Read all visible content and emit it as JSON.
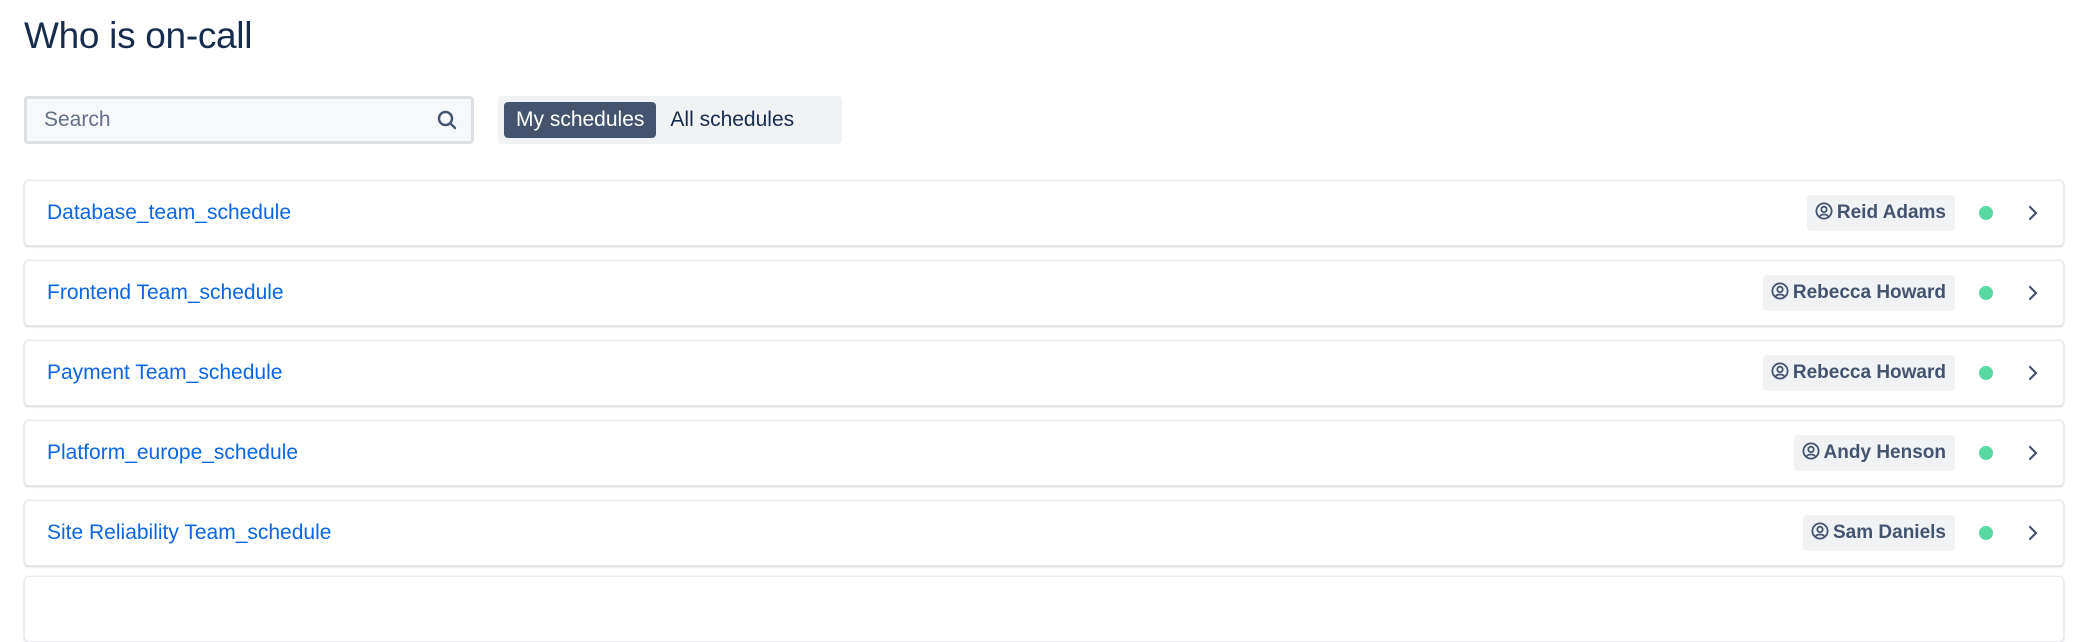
{
  "page": {
    "title": "Who is on-call"
  },
  "search": {
    "placeholder": "Search",
    "value": "",
    "icon": "search-icon"
  },
  "filter_toggle": {
    "options": [
      {
        "label": "My schedules",
        "selected": true
      },
      {
        "label": "All schedules",
        "selected": false
      }
    ]
  },
  "schedules": [
    {
      "name": "Database_team_schedule",
      "on_call": "Reid Adams",
      "status": "active"
    },
    {
      "name": "Frontend Team_schedule",
      "on_call": "Rebecca Howard",
      "status": "active"
    },
    {
      "name": "Payment Team_schedule",
      "on_call": "Rebecca Howard",
      "status": "active"
    },
    {
      "name": "Platform_europe_schedule",
      "on_call": "Andy Henson",
      "status": "active"
    },
    {
      "name": "Site Reliability Team_schedule",
      "on_call": "Sam Daniels",
      "status": "active"
    }
  ],
  "icons": {
    "on_call_user": "user-circle-icon",
    "status": "status-dot",
    "row_action": "chevron-right-icon"
  },
  "colors": {
    "link": "#0C66E4",
    "heading": "#172B4D",
    "toggle_active_bg": "#44546F",
    "badge_bg": "#F1F2F4",
    "badge_text": "#44546F",
    "status_active": "#57D9A3"
  }
}
